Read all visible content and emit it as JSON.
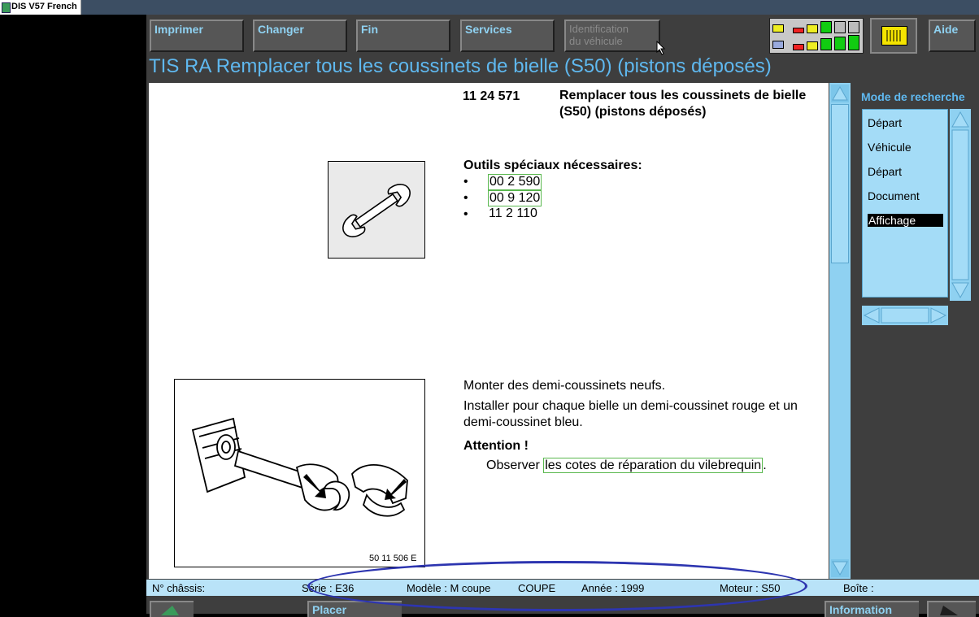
{
  "window": {
    "title": "DIS V57 French"
  },
  "toolbar": {
    "print": "Imprimer",
    "change": "Changer",
    "end": "Fin",
    "services": "Services",
    "vehicle_id_line1": "Identification",
    "vehicle_id_line2": "du véhicule",
    "help": "Aide"
  },
  "page_title": "TIS   RA  Remplacer tous les coussinets de bielle (S50) (pistons déposés)",
  "document": {
    "number": "11 24 571",
    "heading": "Remplacer tous les coussinets de bielle (S50) (pistons déposés)",
    "tools_title": "Outils spéciaux nécessaires:",
    "tools": [
      "00 2 590",
      "00 9 120",
      "11 2 110"
    ],
    "bullet": "•",
    "figure_caption": "50 11 506 E",
    "instruction_1": "Monter des demi-coussinets neufs.",
    "instruction_2": "Installer pour chaque bielle un demi-coussinet rouge et un demi-coussinet bleu.",
    "attention": "Attention !",
    "observe_prefix": "Observer ",
    "observe_link": "les cotes de réparation du vilebrequin",
    "observe_suffix": "."
  },
  "search_panel": {
    "label": "Mode de recherche",
    "items": [
      "Départ",
      "Véhicule",
      "Départ",
      "Document",
      "Affichage"
    ],
    "selected": "Affichage"
  },
  "status_bar": {
    "chassis": "N° châssis:",
    "series": "Série : E36",
    "model": "Modèle : M coupe",
    "body": "COUPE",
    "year": "Année : 1999",
    "engine": "Moteur : S50",
    "gearbox": "Boîte :"
  },
  "bottom_buttons": {
    "place": "Placer",
    "information": "Information"
  },
  "colors": {
    "accent": "#5fb8ef",
    "status_bar": "#b9e3f8",
    "link_border": "#5ab84f",
    "annotation": "#2d35b0"
  }
}
